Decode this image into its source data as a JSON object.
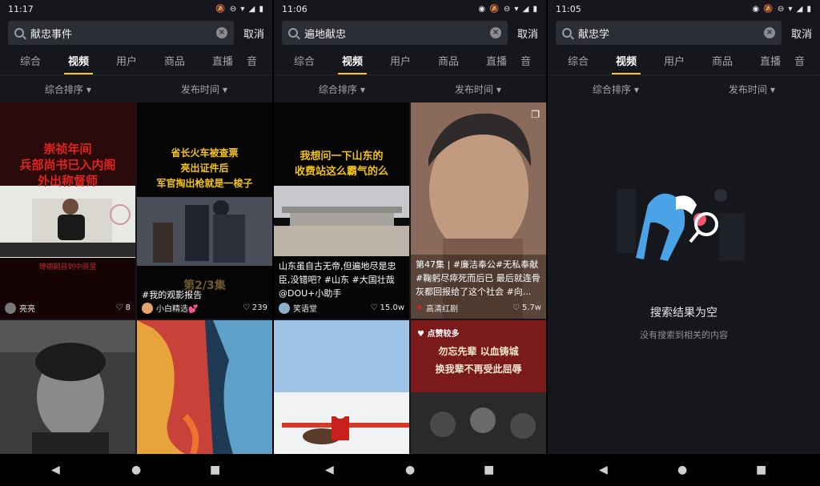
{
  "screens": [
    {
      "status_time": "11:17",
      "status_icons": "🔕 ⊖ ▾ ◢ ▮",
      "search_value": "献忠事件",
      "cancel": "取消",
      "tabs": [
        "综合",
        "视频",
        "用户",
        "商品",
        "直播",
        "音"
      ],
      "active_tab": 1,
      "filters": [
        "综合排序",
        "发布时间"
      ],
      "tiles": [
        {
          "overlay_lines": [
            "崇祯年间",
            "兵部尚书已入内阁",
            "外出称督师"
          ],
          "sub_text": "傅德嗣县到中原里",
          "author": "亮亮",
          "likes": "8"
        },
        {
          "overlay_lines": [
            "省长火车被查票",
            "亮出证件后",
            "军官掏出枪就是一梭子"
          ],
          "episode": "第2/3集",
          "caption": "#我的观影报告",
          "author": "小白精选💕",
          "likes": "239"
        }
      ]
    },
    {
      "status_time": "11:06",
      "status_icons": "◉ 🔕 ⊖ ▾ ◢ ▮",
      "search_value": "遍地献忠",
      "cancel": "取消",
      "tabs": [
        "综合",
        "视频",
        "用户",
        "商品",
        "直播",
        "音"
      ],
      "active_tab": 1,
      "filters": [
        "综合排序",
        "发布时间"
      ],
      "tiles": [
        {
          "overlay_lines": [
            "我想问一下山东的",
            "收费站这么霸气的么"
          ],
          "caption": "山东虽自古无帝,但遍地尽是忠臣,没错吧? #山东 #大国壮哉 @DOU+小助手",
          "author": "笑语堂",
          "likes": "15.0w"
        },
        {
          "caption": "第47集 | #廉洁奉公#无私奉献 #鞠躬尽瘁死而后已 最后就连骨灰都回报给了这个社会 #向...",
          "author": "高清红剧",
          "likes": "5.7w"
        },
        {},
        {
          "badge": "点赞较多",
          "overlay_lines": [
            "勿忘先辈 以血铸城",
            "换我辈不再受此屈辱"
          ]
        }
      ]
    },
    {
      "status_time": "11:05",
      "status_icons": "◉ 🔕 ⊖ ▾ ◢ ▮",
      "search_value": "献忠学",
      "cancel": "取消",
      "tabs": [
        "综合",
        "视频",
        "用户",
        "商品",
        "直播",
        "音"
      ],
      "active_tab": 1,
      "filters": [
        "综合排序",
        "发布时间"
      ],
      "empty_title": "搜索结果为空",
      "empty_subtitle": "没有搜索到相关的内容"
    }
  ],
  "nav": {
    "back": "◀",
    "home": "●",
    "recents": "■"
  },
  "colors": {
    "accent": "#f8c91c",
    "panel_bg": "#15171d",
    "search_bg": "#2c2e35"
  }
}
